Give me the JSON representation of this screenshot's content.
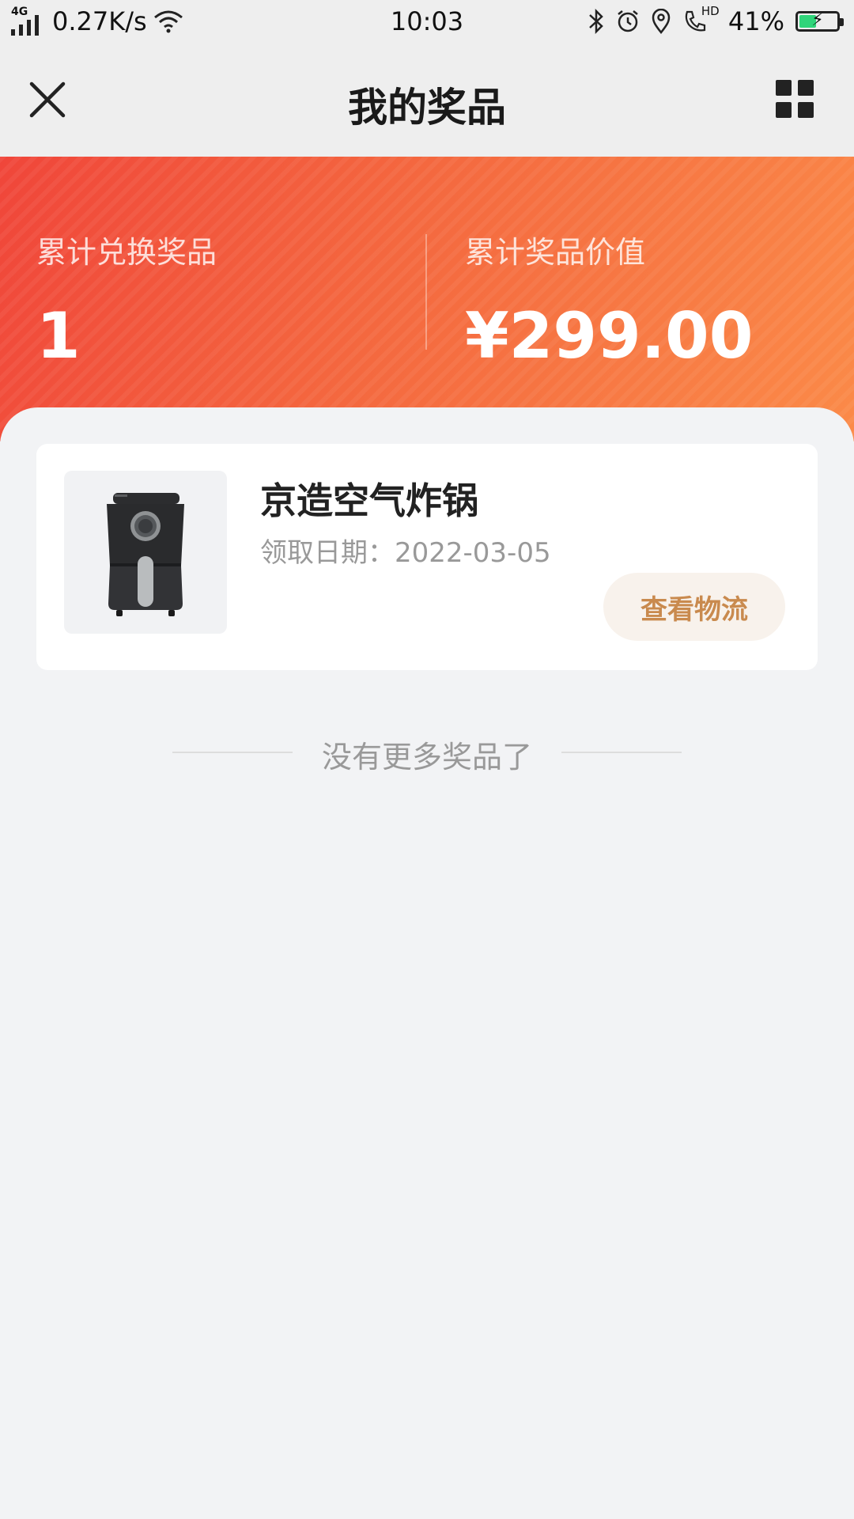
{
  "status_bar": {
    "network_type": "4G",
    "speed": "0.27K/s",
    "time": "10:03",
    "call_badge": "HD",
    "battery_percent_text": "41%",
    "battery_level": 0.41,
    "icons": [
      "signal-icon",
      "wifi-icon",
      "bluetooth-icon",
      "alarm-icon",
      "location-icon",
      "hd-call-icon",
      "battery-icon"
    ]
  },
  "nav": {
    "title": "我的奖品",
    "close_icon": "close-icon",
    "menu_icon": "grid-menu-icon"
  },
  "summary": {
    "left_label": "累计兑换奖品",
    "left_value": "1",
    "right_label": "累计奖品价值",
    "right_value": "¥299.00"
  },
  "prizes": [
    {
      "name": "京造空气炸锅",
      "date_text": "领取日期：2022-03-05",
      "action_label": "查看物流"
    }
  ],
  "list_end_text": "没有更多奖品了",
  "colors": {
    "banner_start": "#f0463a",
    "banner_end": "#fb8a48",
    "button_bg": "#f8f2ec",
    "button_text": "#c98a4e",
    "battery_fill": "#2fd57a"
  }
}
